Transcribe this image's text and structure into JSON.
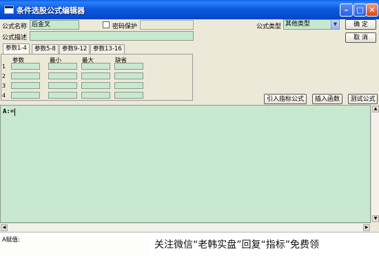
{
  "window": {
    "title": "条件选股公式编辑器",
    "min_glyph": "–",
    "max_glyph": "□",
    "close_glyph": "✕"
  },
  "form": {
    "name_label": "公式名称",
    "name_value": "后金叉",
    "password_label": "密码保护",
    "password_checked": false,
    "desc_label": "公式描述",
    "desc_value": "",
    "type_label": "公式类型",
    "type_value": "其他类型"
  },
  "buttons": {
    "ok": "确  定",
    "cancel": "取  消",
    "import_indicator": "引入指标公式",
    "insert_function": "插入函数",
    "test_formula": "测试公式"
  },
  "tabs": [
    "参数1-4",
    "参数5-8",
    "参数9-12",
    "参数13-16"
  ],
  "active_tab": 0,
  "params": {
    "headers": [
      "参数",
      "最小",
      "最大",
      "缺省"
    ],
    "rows": [
      "1",
      "2",
      "3",
      "4"
    ]
  },
  "editor": {
    "text": "A:="
  },
  "status": {
    "text": "A赋值:"
  },
  "watermark": {
    "text": "关注微信“老韩实盘”回复“指标”免费领"
  },
  "colors": {
    "titlebar": "#0b5be0",
    "field_green": "#c8e8d0",
    "dialog_bg": "#ece9d8"
  }
}
